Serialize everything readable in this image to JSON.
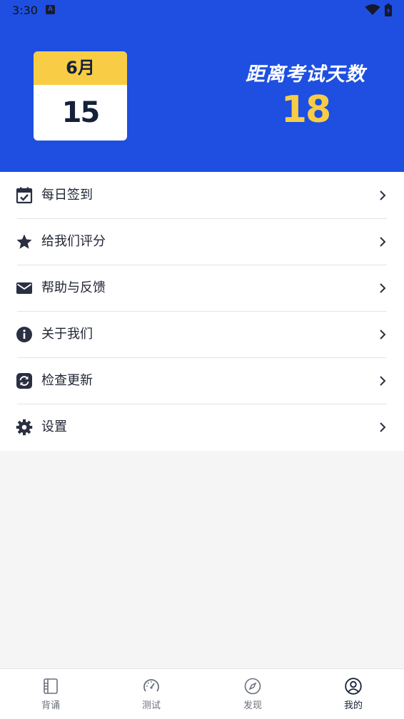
{
  "status_bar": {
    "time": "3:30",
    "notification_icon": "a-icon",
    "wifi_icon": "wifi-icon",
    "battery_icon": "battery-charging-icon"
  },
  "header": {
    "background_color": "#1e4fe0",
    "calendar": {
      "month": "6月",
      "day": "15",
      "month_color": "#f8cd45"
    },
    "countdown": {
      "title": "距离考试天数",
      "value": "18",
      "value_color": "#f8cd45"
    }
  },
  "menu": {
    "items": [
      {
        "label": "每日签到",
        "icon": "calendar-check-icon"
      },
      {
        "label": "给我们评分",
        "icon": "star-icon"
      },
      {
        "label": "帮助与反馈",
        "icon": "mail-icon"
      },
      {
        "label": "关于我们",
        "icon": "info-icon"
      },
      {
        "label": "检查更新",
        "icon": "refresh-icon"
      },
      {
        "label": "设置",
        "icon": "gear-icon"
      }
    ]
  },
  "tabbar": {
    "tabs": [
      {
        "label": "背诵",
        "icon": "notebook-icon",
        "active": false
      },
      {
        "label": "测试",
        "icon": "speedometer-icon",
        "active": false
      },
      {
        "label": "发现",
        "icon": "compass-icon",
        "active": false
      },
      {
        "label": "我的",
        "icon": "user-circle-icon",
        "active": true
      }
    ]
  }
}
